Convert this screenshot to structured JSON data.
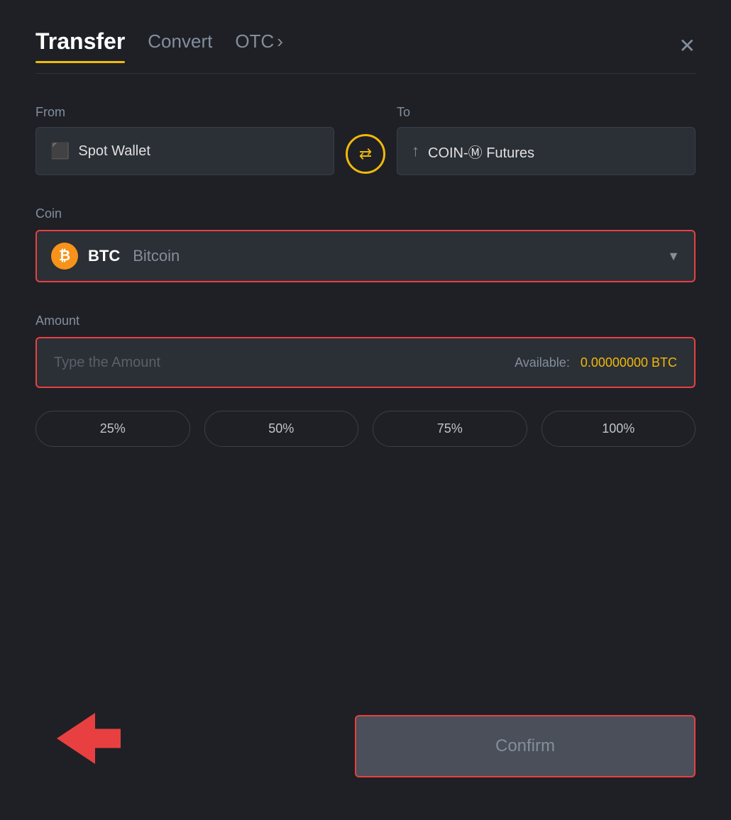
{
  "header": {
    "tab_transfer": "Transfer",
    "tab_convert": "Convert",
    "tab_otc": "OTC",
    "tab_otc_chevron": "›",
    "close_label": "✕"
  },
  "from_section": {
    "label": "From",
    "wallet_icon": "▬",
    "wallet_name": "Spot Wallet"
  },
  "to_section": {
    "label": "To",
    "wallet_icon": "↑",
    "wallet_name": "COIN-Ⓜ Futures"
  },
  "swap": {
    "icon": "⇄"
  },
  "coin_section": {
    "label": "Coin",
    "coin_ticker": "BTC",
    "coin_name": "Bitcoin",
    "chevron": "▼"
  },
  "amount_section": {
    "label": "Amount",
    "placeholder": "Type the Amount",
    "available_label": "Available:",
    "available_amount": "0.00000000",
    "available_currency": "BTC"
  },
  "percent_buttons": [
    "25%",
    "50%",
    "75%",
    "100%"
  ],
  "confirm_button": {
    "label": "Confirm"
  }
}
